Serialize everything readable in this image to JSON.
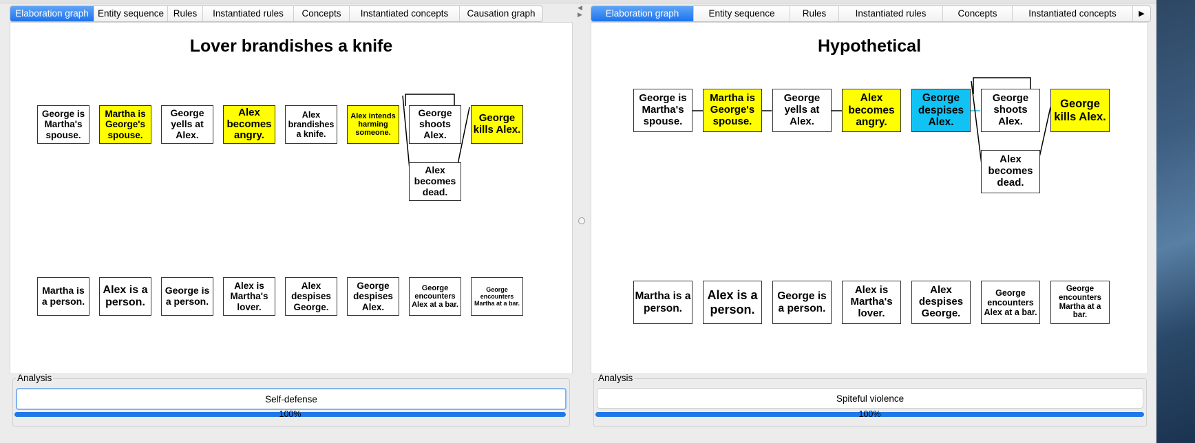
{
  "left_pane": {
    "tabs": [
      "Elaboration graph",
      "Entity sequence",
      "Rules",
      "Instantiated rules",
      "Concepts",
      "Instantiated concepts",
      "Causation graph"
    ],
    "title": "Lover brandishes a knife",
    "top_nodes": [
      {
        "label": "George is Martha's spouse.",
        "color": "white"
      },
      {
        "label": "Martha is George's spouse.",
        "color": "yellow"
      },
      {
        "label": "George yells at Alex.",
        "color": "white"
      },
      {
        "label": "Alex becomes angry.",
        "color": "yellow"
      },
      {
        "label": "Alex brandishes a knife.",
        "color": "white"
      },
      {
        "label": "Alex intends harming someone.",
        "color": "yellow"
      },
      {
        "label": "George shoots Alex.",
        "color": "white"
      },
      {
        "label": "George kills Alex.",
        "color": "yellow"
      },
      {
        "label": "Alex becomes dead.",
        "color": "white"
      }
    ],
    "bottom_nodes": [
      "Martha is a person.",
      "Alex is a person.",
      "George is a person.",
      "Alex is Martha's lover.",
      "Alex despises George.",
      "George despises Alex.",
      "George encounters Alex at a bar.",
      "George encounters Martha at a bar."
    ],
    "analysis_legend": "Analysis",
    "analysis_result": "Self-defense",
    "progress_text": "100%",
    "progress_value": 1.0
  },
  "right_pane": {
    "tabs": [
      "Elaboration graph",
      "Entity sequence",
      "Rules",
      "Instantiated rules",
      "Concepts",
      "Instantiated concepts"
    ],
    "more_icon": "triangle-right-icon",
    "title": "Hypothetical",
    "top_nodes": [
      {
        "label": "George is Martha's spouse.",
        "color": "white"
      },
      {
        "label": "Martha is George's spouse.",
        "color": "yellow"
      },
      {
        "label": "George yells at Alex.",
        "color": "white"
      },
      {
        "label": "Alex becomes angry.",
        "color": "yellow"
      },
      {
        "label": "George despises Alex.",
        "color": "cyan"
      },
      {
        "label": "George shoots Alex.",
        "color": "white"
      },
      {
        "label": "George kills Alex.",
        "color": "yellow"
      },
      {
        "label": "Alex becomes dead.",
        "color": "white"
      }
    ],
    "bottom_nodes": [
      "Martha is a person.",
      "Alex is a person.",
      "George is a person.",
      "Alex is Martha's lover.",
      "Alex despises George.",
      "George encounters Alex at a bar.",
      "George encounters Martha at a bar."
    ],
    "analysis_legend": "Analysis",
    "analysis_result": "Spiteful violence",
    "progress_text": "100%",
    "progress_value": 1.0
  },
  "colors": {
    "yellow": "#ffff00",
    "cyan": "#11c3f5",
    "tab_active": "#1c74ec",
    "progress": "#1f78e8",
    "edge_yellow": "#e8c200",
    "edge_cyan": "#11c3f5"
  }
}
